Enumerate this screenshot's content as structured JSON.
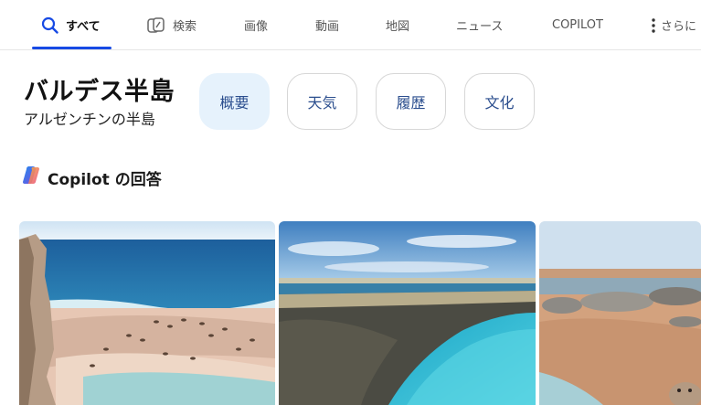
{
  "nav": {
    "tabs": [
      {
        "label": "すべて",
        "icon": "search-icon",
        "active": true
      },
      {
        "label": "検索",
        "icon": "copilot-search-icon"
      },
      {
        "label": "画像"
      },
      {
        "label": "動画"
      },
      {
        "label": "地図"
      },
      {
        "label": "ニュース"
      },
      {
        "label": "COPILOT"
      },
      {
        "label": "さらに",
        "icon": "more-vertical-icon"
      }
    ],
    "accent": "#174ae4"
  },
  "entity": {
    "title": "バルデス半島",
    "subtitle": "アルゼンチンの半島"
  },
  "pills": [
    {
      "label": "概要",
      "active": true
    },
    {
      "label": "天気"
    },
    {
      "label": "履歴"
    },
    {
      "label": "文化"
    }
  ],
  "copilot": {
    "heading": "Copilot の回答",
    "icon": "copilot-logo-icon"
  },
  "images": [
    {
      "name": "coastal-cliff-sea-lions-image"
    },
    {
      "name": "canyon-coast-image"
    },
    {
      "name": "elephant-seals-beach-image"
    }
  ]
}
